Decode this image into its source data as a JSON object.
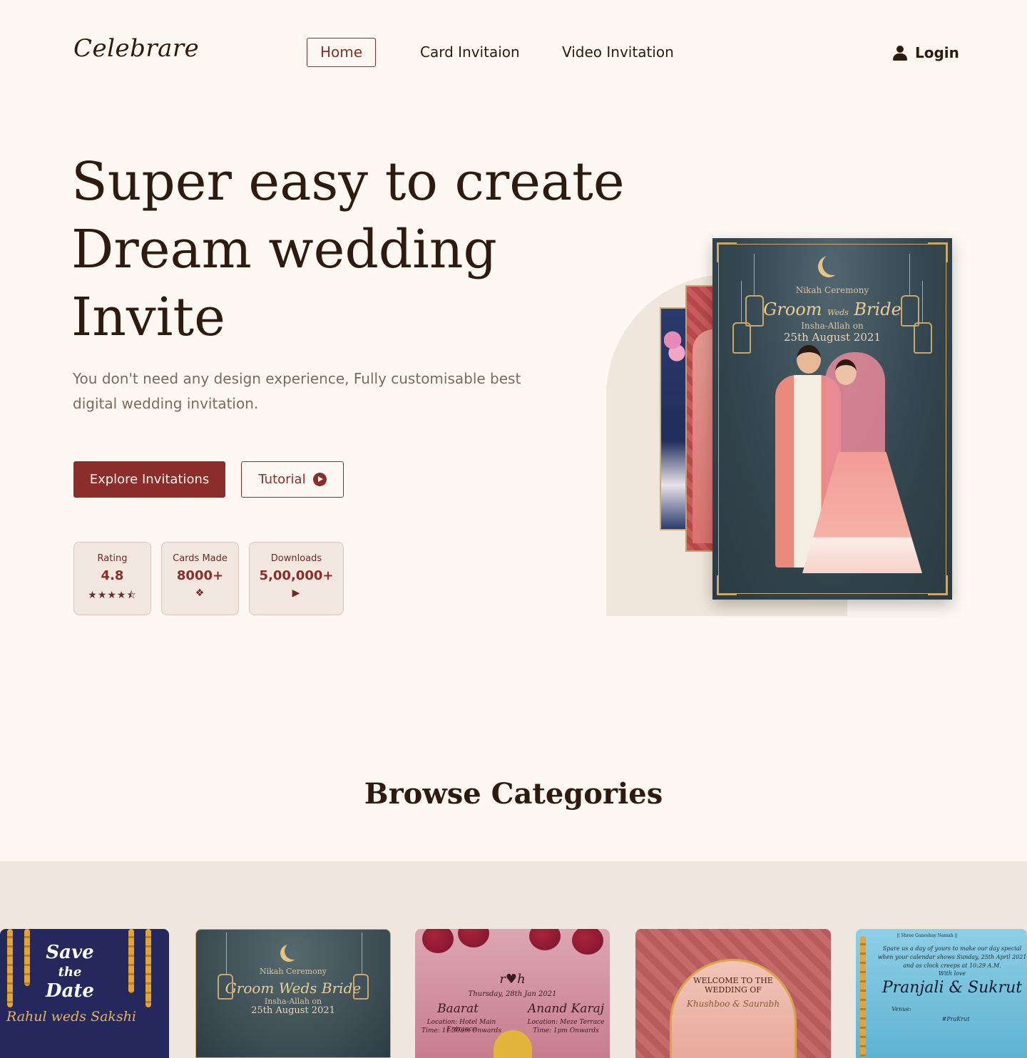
{
  "nav": {
    "logo": "Celebrare",
    "links": [
      "Home",
      "Card Invitaion",
      "Video Invitation"
    ],
    "active": "Home",
    "login": "Login"
  },
  "hero": {
    "title_lines": [
      "Super easy to create",
      "Dream wedding",
      "Invite"
    ],
    "subtitle": "You don't need any design experience, Fully customisable best digital wedding invitation.",
    "cta_primary": "Explore Invitations",
    "cta_secondary": "Tutorial",
    "stats": [
      {
        "label": "Rating",
        "value": "4.8",
        "icon": "★★★★⯪"
      },
      {
        "label": "Cards Made",
        "value": "8000+",
        "icon": "❖"
      },
      {
        "label": "Downloads",
        "value": "5,00,000+",
        "icon": "▶"
      }
    ]
  },
  "hero_card": {
    "ceremony": "Nikah Ceremony",
    "groom": "Groom",
    "weds": "Weds",
    "bride": "Bride",
    "insha": "Insha-Allah on",
    "date": "25th August 2021"
  },
  "browse": {
    "title": "Browse Categories",
    "cards": [
      {
        "line1": "Save",
        "line2": "the",
        "line3": "Date",
        "names": "Rahul weds Sakshi"
      },
      {
        "ceremony": "Nikah Ceremony",
        "names": "Groom Weds Bride",
        "insha": "Insha-Allah on",
        "date": "25th August 2021"
      },
      {
        "monogram": "r♥h",
        "date": "Thursday, 28th Jan 2021",
        "left_event": "Baarat",
        "right_event": "Anand Karaj",
        "left_loc": "Location: Hotel Main Entrance",
        "left_time": "Time: 11.30am Onwards",
        "right_loc": "Location: Meze Terrace",
        "right_time": "Time: 1pm Onwards"
      },
      {
        "welcome": "WELCOME TO THE WEDDING OF",
        "names": "Khushboo & Saurabh"
      },
      {
        "top": "|| Shree Ganeshay Namah ||",
        "msg": "Spare us a day of yours to make our day special when your calendar shows Sunday, 25th April 2021 and as clock creeps at 10:29 A.M.",
        "with_love": "With love",
        "names": "Pranjali & Sukrut",
        "venue": "Venue:",
        "tag": "#PraKrut"
      }
    ]
  },
  "colors": {
    "background": "#FDF9F2",
    "primary": "#8B2D2A",
    "text": "#2E1A0E",
    "muted": "#7A6A5E",
    "stat_bg": "#F2E7DE",
    "band": "#EFE6DD"
  }
}
